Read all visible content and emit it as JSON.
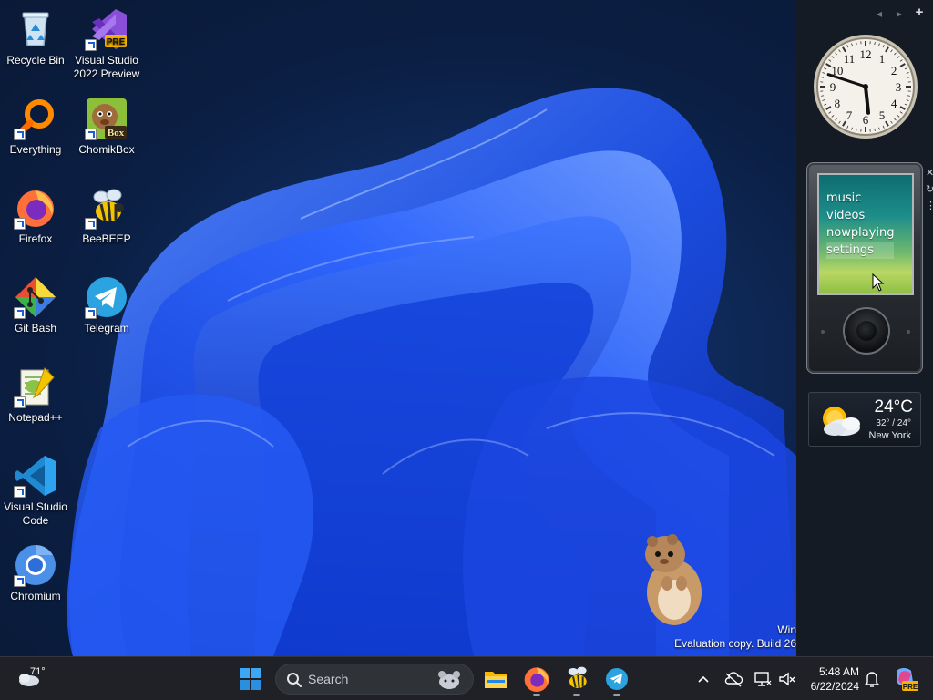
{
  "desktop_icons": [
    {
      "label": "Recycle Bin",
      "icon": "recycle-bin-icon"
    },
    {
      "label": "Visual Studio 2022 Preview",
      "icon": "visual-studio-preview-icon",
      "badge": "PRE"
    },
    {
      "label": "Everything",
      "icon": "everything-search-icon"
    },
    {
      "label": "ChomikBox",
      "icon": "chomikbox-icon",
      "badge": "Box"
    },
    {
      "label": "Firefox",
      "icon": "firefox-icon"
    },
    {
      "label": "BeeBEEP",
      "icon": "beebeep-icon"
    },
    {
      "label": "Git Bash",
      "icon": "git-bash-icon"
    },
    {
      "label": "Telegram",
      "icon": "telegram-icon"
    },
    {
      "label": "Notepad++",
      "icon": "notepad-plus-plus-icon"
    },
    {
      "label": "Visual Studio Code",
      "icon": "vscode-icon"
    },
    {
      "label": "Chromium",
      "icon": "chromium-icon"
    }
  ],
  "watermark": {
    "line1": "Win",
    "line2": "Evaluation copy. Build 26"
  },
  "sidebar": {
    "controls": {
      "prev": "◂",
      "next": "▸",
      "add": "+"
    },
    "clock": {
      "hour": 5,
      "minute": 48,
      "numerals": [
        "12",
        "1",
        "2",
        "3",
        "4",
        "5",
        "6",
        "7",
        "8",
        "9",
        "10",
        "11"
      ]
    },
    "zune": {
      "menu": [
        "music",
        "videos",
        "nowplaying",
        "settings"
      ],
      "selected_index": 3,
      "side_buttons": [
        "✕",
        "↻",
        "⋮"
      ]
    },
    "weather": {
      "temperature": "24°C",
      "range": "32° / 24°",
      "city": "New York",
      "icon": "partly-cloudy-icon"
    }
  },
  "taskbar": {
    "weather_temp": "71°",
    "search_placeholder": "Search",
    "pinned_apps": [
      {
        "name": "file-explorer",
        "icon": "folder-icon",
        "running": false
      },
      {
        "name": "firefox",
        "icon": "firefox-icon",
        "running": true
      },
      {
        "name": "beebeep",
        "icon": "beebeep-icon",
        "running": true
      },
      {
        "name": "telegram",
        "icon": "telegram-icon",
        "running": true
      }
    ],
    "tray_icons": [
      "chevron-up-icon",
      "onedrive-off-icon",
      "network-icon",
      "volume-muted-icon"
    ],
    "time": "5:48 AM",
    "date": "6/22/2024",
    "copilot_badge": "PRE"
  },
  "colors": {
    "accent": "#1a5fd6",
    "taskbar": "#1f2126",
    "sidebar": "#141b24"
  }
}
